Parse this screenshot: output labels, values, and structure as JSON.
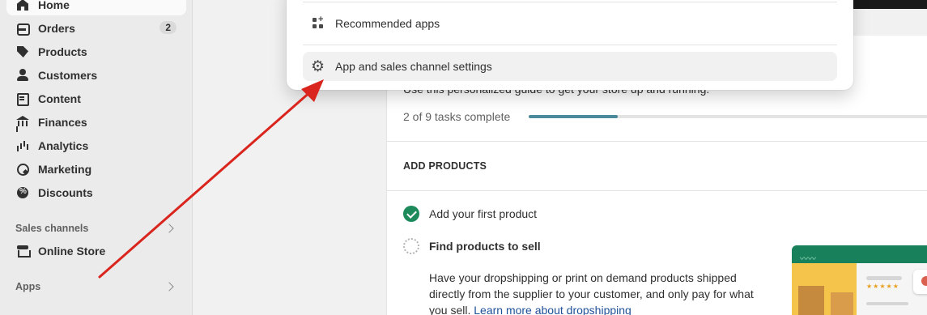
{
  "sidebar": {
    "items": [
      {
        "label": "Home",
        "icon": "home-icon"
      },
      {
        "label": "Orders",
        "icon": "orders-icon",
        "badge": "2"
      },
      {
        "label": "Products",
        "icon": "tag-icon"
      },
      {
        "label": "Customers",
        "icon": "person-icon"
      },
      {
        "label": "Content",
        "icon": "content-icon"
      },
      {
        "label": "Finances",
        "icon": "bank-icon"
      },
      {
        "label": "Analytics",
        "icon": "bar-chart-icon"
      },
      {
        "label": "Marketing",
        "icon": "target-icon"
      },
      {
        "label": "Discounts",
        "icon": "discount-icon"
      }
    ],
    "sales_channels_label": "Sales channels",
    "online_store_label": "Online Store",
    "apps_label": "Apps"
  },
  "popover": {
    "recommended_apps": "Recommended apps",
    "settings": "App and sales channel settings"
  },
  "setup_guide": {
    "subtext": "Use this personalized guide to get your store up and running.",
    "tasks_complete": "2 of 9 tasks complete",
    "progress_fraction": 0.2222,
    "section_title": "ADD PRODUCTS",
    "task_1": "Add your first product",
    "task_2": "Find products to sell",
    "task_2_desc": "Have your dropshipping or print on demand products shipped directly from the supplier to your customer, and only pay for what you sell. ",
    "task_2_link": "Learn more about dropshipping"
  },
  "colors": {
    "progress": "#4a8a9a",
    "check": "#1c8a5a",
    "arrow": "#d9251d",
    "link": "#1f5199"
  }
}
